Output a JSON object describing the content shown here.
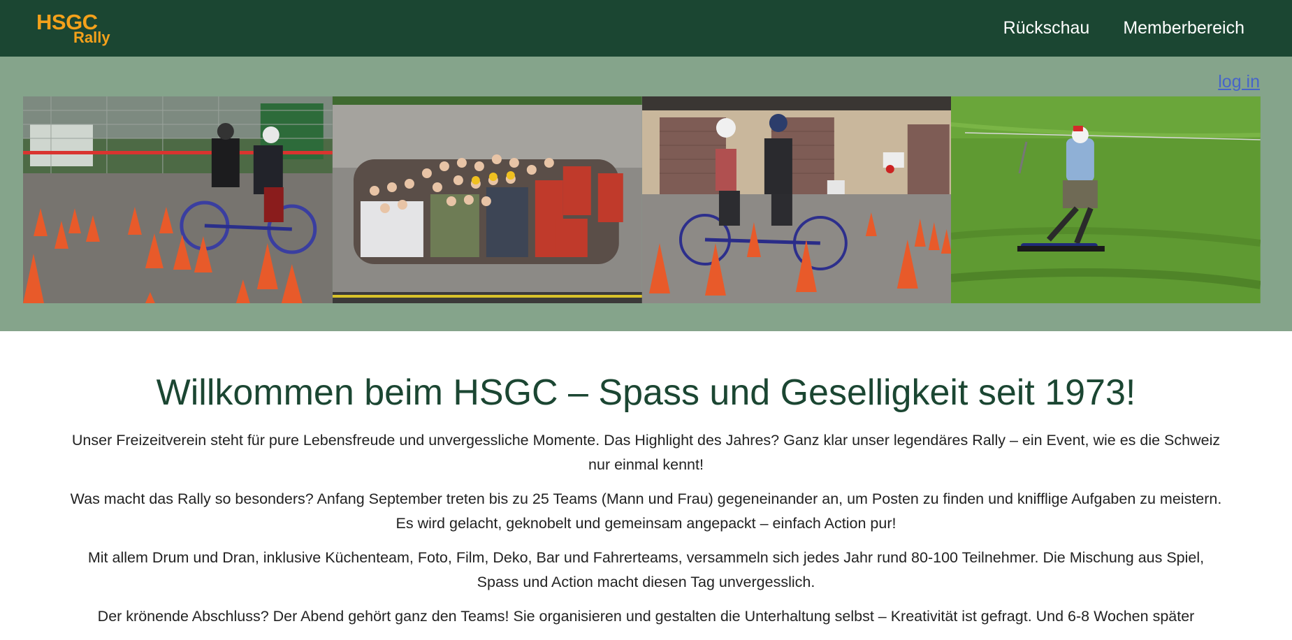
{
  "header": {
    "logo_line1": "HSGC",
    "logo_line2": "Rally",
    "nav": [
      {
        "label": "Rückschau"
      },
      {
        "label": "Memberbereich"
      }
    ]
  },
  "hero": {
    "login_label": "log in",
    "photos": [
      {
        "icon": "tandem-bike-cones-photo"
      },
      {
        "icon": "group-photo"
      },
      {
        "icon": "tandem-bike-garage-photo"
      },
      {
        "icon": "grass-ski-photo"
      }
    ]
  },
  "main": {
    "title": "Willkommen beim HSGC – Spass und Geselligkeit seit 1973!",
    "paragraphs": [
      "Unser Freizeitverein steht für pure Lebensfreude und unvergessliche Momente. Das Highlight des Jahres? Ganz klar unser legendäres Rally – ein Event, wie es die Schweiz nur einmal kennt!",
      "Was macht das Rally so besonders? Anfang September treten bis zu 25 Teams (Mann und Frau) gegeneinander an, um Posten zu finden und knifflige Aufgaben zu meistern. Es wird gelacht, geknobelt und gemeinsam angepackt – einfach Action pur!",
      "Mit allem Drum und Dran, inklusive Küchenteam, Foto, Film, Deko, Bar und Fahrerteams, versammeln sich jedes Jahr rund 80-100 Teilnehmer. Die Mischung aus Spiel, Spass und Action macht diesen Tag unvergesslich.",
      "Der krönende Abschluss? Der Abend gehört ganz den Teams! Sie organisieren und gestalten die Unterhaltung selbst – Kreativität ist gefragt. Und 6-8 Wochen später"
    ]
  },
  "colors": {
    "header_bg": "#1b4632",
    "hero_bg": "#85a48b",
    "logo": "#f4a11b",
    "title": "#1b4632",
    "link": "#4765c9"
  }
}
